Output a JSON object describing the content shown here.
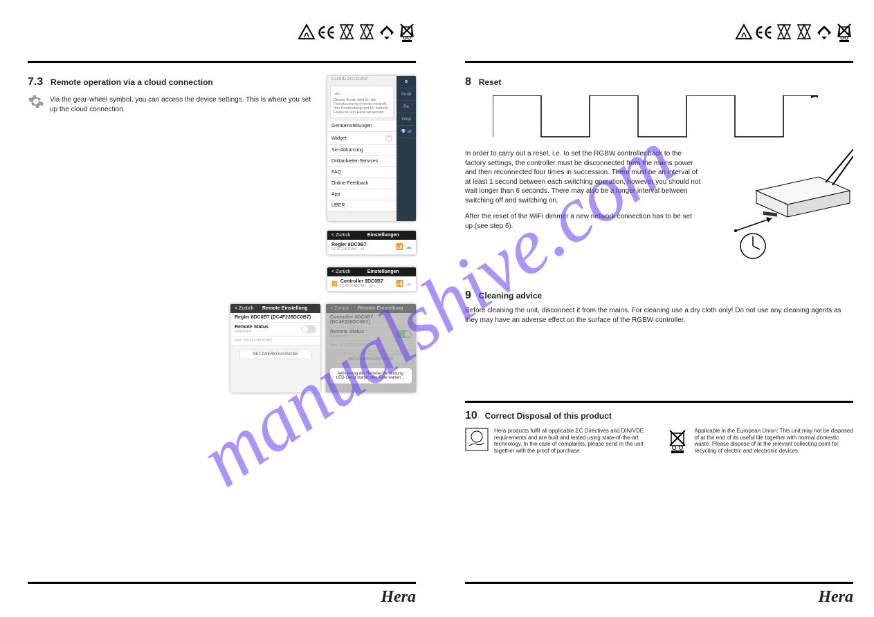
{
  "brand": "Hera",
  "watermark": "manualshive.com",
  "left_page": {
    "section": {
      "num": "7.3",
      "title": "Remote operation via a cloud connection",
      "para": "Via the gear-wheel symbol, you can access the device settings. This is where you set up the cloud connection."
    },
    "phone1": {
      "cloud_section": "CLOUD-ACCOUNT",
      "cloud_desc": "Dieses Konto wird für die Fernsteuerung (remote control), Ihre Bearbeitung und für weitere Features von Hera verwendet.",
      "items": [
        "Geräteinstellungen",
        "Widget",
        "Siri-Abkürzung",
        "Drittanbieter-Services",
        "FAQ",
        "Online-Feedback",
        "App",
        "ÜBER"
      ],
      "side": [
        "⚙",
        "Gerät",
        "Re",
        "Grup",
        "💎 all"
      ],
      "q_badge": "?"
    },
    "phone2": {
      "back": "< Zurück",
      "title": "Einstellungen",
      "device": "Regler 8DC0B7",
      "mac": "DC4F228DC0B7 · v3"
    },
    "phone3": {
      "back": "< Zurück",
      "title": "Einstellungen",
      "device": "Controller 8DC0B7",
      "mac": "DC4F228DC0B7 · v3"
    },
    "phone4": {
      "back": "< Zurück",
      "title": "Remote Einstellung",
      "device": "Regler 8DC0B7 (DC4F228DC0B7)",
      "status": "Remote Status",
      "status_sub": "Deaktiviert",
      "mac": "Mac: DC4F228DC0B7",
      "net": "NETZWERKDIAGNOSE"
    },
    "phone5": {
      "back": "< Zurück",
      "title": "Remote Einstellung",
      "device": "Controller 8DC0B7 (DC4F228DC0B7)",
      "status": "Remote Status",
      "status_sub": "Deaktiviert",
      "mac": "Mac: DC4F228DC0B7",
      "net": "NETZWERKDIAGNOSE",
      "popup": "Aktivierung der Remote-Verbindung. LED-Gerät startet neu. Bitte warten ..."
    }
  },
  "right_page": {
    "s8": {
      "num": "8",
      "title": "Reset",
      "para1": "In order to carry out a reset, i.e. to set the RGBW controller back to the factory settings, the controller must be disconnected from the mains power and then reconnected four times in succession. There must be an interval of at least 1 second between each switching operation, however you should not wait longer than 6 seconds. There may also be a longer interval between switching off and switching on.",
      "para2": "After the reset of the WiFi dimmer a new network connection has to be set up (see step 6)."
    },
    "s9": {
      "num": "9",
      "title": "Cleaning advice",
      "para": "Before cleaning the unit, disconnect it from the mains. For cleaning use a dry cloth only! Do not use any cleaning agents as they may have an adverse effect on the surface of the RGBW controller."
    },
    "s10": {
      "num": "10",
      "title": "Correct Disposal of this product",
      "col1": "Hera products fulfil all applicable EC Directives and DIN/VDE requirements and are built and tested using state-of-the-art technology. In the case of complaints, please send in the unit together with the proof of purchase.",
      "col2": "Applicable in the European Union: This unit may not be disposed of at the end of its useful life together with normal domestic waste. Please dispose of at the relevant collecting point for recycling of electric and electronic devices."
    }
  }
}
